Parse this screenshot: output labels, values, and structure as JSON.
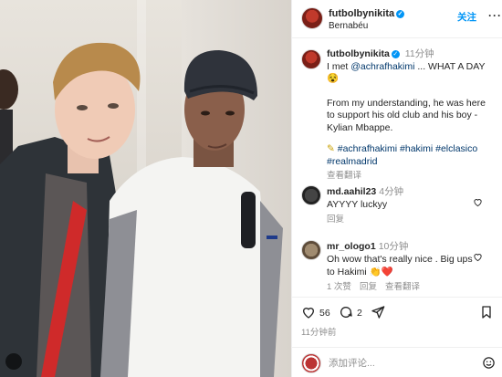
{
  "header": {
    "username": "futbolbynikita",
    "location": "Bernabéu",
    "follow_label": "关注",
    "more_label": "···"
  },
  "caption": {
    "username": "futbolbynikita",
    "time": "11分钟",
    "line1_prefix": "I met ",
    "mention": "@achrafhakimi",
    "line1_suffix": " ... WHAT A DAY",
    "line1_emoji": "😵",
    "para2": "From my understanding, he was here to support his old club and his boy - Kylian Mbappe.",
    "pencil": "✎",
    "tags": "#achrafhakimi #hakimi #elclasico #realmadrid",
    "translate_label": "查看翻译"
  },
  "comments": [
    {
      "username": "md.aahil23",
      "time": "4分钟",
      "text": "AYYYY luckyy",
      "actions": [
        "回复"
      ]
    },
    {
      "username": "mr_ologo1",
      "time": "10分钟",
      "text": "Oh wow that's really nice . Big ups to Hakimi",
      "emoji": "👏❤️",
      "actions": [
        "1 次赞",
        "回复",
        "查看翻译"
      ]
    }
  ],
  "stats": {
    "likes": "56",
    "comments": "2",
    "date": "11分钟前"
  },
  "compose": {
    "placeholder": "添加评论..."
  },
  "colors": {
    "accent": "#0095f6",
    "link": "#00376b",
    "muted": "#8e8e8e"
  }
}
